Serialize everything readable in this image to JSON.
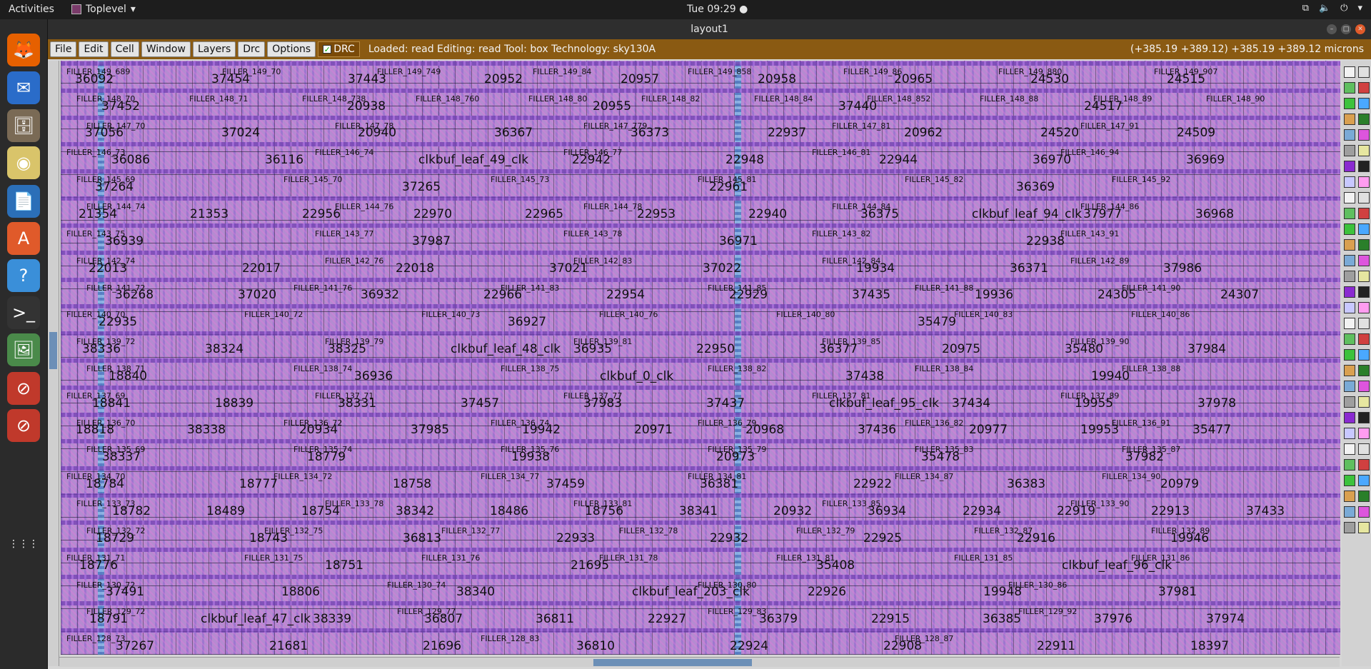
{
  "topbar": {
    "activities": "Activities",
    "app_name": "Toplevel",
    "clock": "Tue 09:29"
  },
  "window": {
    "title": "layout1",
    "menu": [
      "File",
      "Edit",
      "Cell",
      "Window",
      "Layers",
      "Drc",
      "Options"
    ],
    "drc_label": "DRC",
    "status": "Loaded: read  Editing: read  Tool: box   Technology: sky130A",
    "coords": "(+385.19 +389.12) +385.19 +389.12 microns"
  },
  "dock": {
    "items": [
      "firefox-icon",
      "thunderbird-icon",
      "files-icon",
      "rhythmbox-icon",
      "writer-icon",
      "software-icon",
      "help-icon",
      "terminal-icon",
      "image-viewer-icon",
      "app-icon",
      "app-icon",
      "show-apps-icon"
    ]
  },
  "layout": {
    "rows": [
      {
        "small": [
          "FILLER_149_689",
          "FILLER_149_70",
          "FILLER_149_749",
          "FILLER_149_84",
          "FILLER_149_858",
          "FILLER_149_86",
          "FILLER_149_880",
          "FILLER_149_907"
        ],
        "big": [
          "36092",
          "37454",
          "37443",
          "20952",
          "20957",
          "20958",
          "20965",
          "24530",
          "24515"
        ]
      },
      {
        "small": [
          "FILLER_148_70",
          "FILLER_148_71",
          "FILLER_148_738",
          "FILLER_148_760",
          "FILLER_148_80",
          "FILLER_148_82",
          "FILLER_148_84",
          "FILLER_148_852",
          "FILLER_148_88",
          "FILLER_148_89",
          "FILLER_148_90"
        ],
        "big": [
          "37452",
          "20938",
          "20955",
          "37440",
          "24517"
        ]
      },
      {
        "small": [
          "FILLER_147_70",
          "FILLER_147_78",
          "FILLER_147_779",
          "FILLER_147_81",
          "FILLER_147_91"
        ],
        "big": [
          "37056",
          "37024",
          "20940",
          "36367",
          "36373",
          "22937",
          "20962",
          "24520",
          "24509"
        ]
      },
      {
        "small": [
          "FILLER_146_73",
          "FILLER_146_74",
          "FILLER_146_77",
          "FILLER_146_81",
          "FILLER_146_94"
        ],
        "big": [
          "36086",
          "36116",
          "clkbuf_leaf_49_clk",
          "22942",
          "22948",
          "22944",
          "36970",
          "36969"
        ]
      },
      {
        "small": [
          "FILLER_145_69",
          "FILLER_145_70",
          "FILLER_145_73",
          "FILLER_145_81",
          "FILLER_145_82",
          "FILLER_145_92"
        ],
        "big": [
          "37264",
          "37265",
          "22961",
          "36369"
        ]
      },
      {
        "small": [
          "FILLER_144_74",
          "FILLER_144_76",
          "FILLER_144_78",
          "FILLER_144_84",
          "FILLER_144_86"
        ],
        "big": [
          "21354",
          "21353",
          "22956",
          "22970",
          "22965",
          "22953",
          "22940",
          "36375",
          "clkbuf_leaf_94_clk",
          "37977",
          "36968"
        ]
      },
      {
        "small": [
          "FILLER_143_75",
          "FILLER_143_77",
          "FILLER_143_78",
          "FILLER_143_82",
          "FILLER_143_91"
        ],
        "big": [
          "36939",
          "37987",
          "36971",
          "22938"
        ]
      },
      {
        "small": [
          "FILLER_142_74",
          "FILLER_142_76",
          "FILLER_142_83",
          "FILLER_142_84",
          "FILLER_142_89"
        ],
        "big": [
          "22013",
          "22017",
          "22018",
          "37021",
          "37022",
          "19934",
          "36371",
          "37986"
        ]
      },
      {
        "small": [
          "FILLER_141_72",
          "FILLER_141_76",
          "FILLER_141_83",
          "FILLER_141_85",
          "FILLER_141_88",
          "FILLER_141_90"
        ],
        "big": [
          "36268",
          "37020",
          "36932",
          "22966",
          "22954",
          "22929",
          "37435",
          "19936",
          "24305",
          "24307"
        ]
      },
      {
        "small": [
          "FILLER_140_70",
          "FILLER_140_72",
          "FILLER_140_73",
          "FILLER_140_76",
          "FILLER_140_80",
          "FILLER_140_83",
          "FILLER_140_86"
        ],
        "big": [
          "22935",
          "36927",
          "35479"
        ]
      },
      {
        "small": [
          "FILLER_139_72",
          "FILLER_139_79",
          "FILLER_139_81",
          "FILLER_139_85",
          "FILLER_139_90"
        ],
        "big": [
          "38336",
          "38324",
          "38325",
          "clkbuf_leaf_48_clk",
          "36935",
          "22950",
          "36377",
          "20975",
          "35480",
          "37984"
        ]
      },
      {
        "small": [
          "FILLER_138_71",
          "FILLER_138_74",
          "FILLER_138_75",
          "FILLER_138_82",
          "FILLER_138_84",
          "FILLER_138_88"
        ],
        "big": [
          "18840",
          "36936",
          "clkbuf_0_clk",
          "37438",
          "19940"
        ]
      },
      {
        "small": [
          "FILLER_137_69",
          "FILLER_137_71",
          "FILLER_137_77",
          "FILLER_137_81",
          "FILLER_137_89"
        ],
        "big": [
          "18841",
          "18839",
          "38331",
          "37457",
          "37983",
          "37437",
          "clkbuf_leaf_95_clk",
          "37434",
          "19955",
          "37978"
        ]
      },
      {
        "small": [
          "FILLER_136_70",
          "FILLER_136_72",
          "FILLER_136_74",
          "FILLER_136_79",
          "FILLER_136_82",
          "FILLER_136_91"
        ],
        "big": [
          "18818",
          "38338",
          "20934",
          "37985",
          "19942",
          "20971",
          "20968",
          "37436",
          "20977",
          "19953",
          "35477"
        ]
      },
      {
        "small": [
          "FILLER_135_69",
          "FILLER_135_74",
          "FILLER_135_76",
          "FILLER_135_79",
          "FILLER_135_83",
          "FILLER_135_87"
        ],
        "big": [
          "38337",
          "18779",
          "19938",
          "20973",
          "35478",
          "37982"
        ]
      },
      {
        "small": [
          "FILLER_134_70",
          "FILLER_134_72",
          "FILLER_134_77",
          "FILLER_134_81",
          "FILLER_134_87",
          "FILLER_134_90"
        ],
        "big": [
          "18784",
          "18777",
          "18758",
          "37459",
          "36381",
          "22922",
          "36383",
          "20979"
        ]
      },
      {
        "small": [
          "FILLER_133_73",
          "FILLER_133_78",
          "FILLER_133_81",
          "FILLER_133_85",
          "FILLER_133_90"
        ],
        "big": [
          "18782",
          "18489",
          "18754",
          "38342",
          "18486",
          "18756",
          "38341",
          "20932",
          "36934",
          "22934",
          "22919",
          "22913",
          "37433"
        ]
      },
      {
        "small": [
          "FILLER_132_72",
          "FILLER_132_75",
          "FILLER_132_77",
          "FILLER_132_78",
          "FILLER_132_79",
          "FILLER_132_87",
          "FILLER_132_89"
        ],
        "big": [
          "18729",
          "18743",
          "36813",
          "22933",
          "22932",
          "22925",
          "22916",
          "19946"
        ]
      },
      {
        "small": [
          "FILLER_131_71",
          "FILLER_131_75",
          "FILLER_131_76",
          "FILLER_131_78",
          "FILLER_131_81",
          "FILLER_131_85",
          "FILLER_131_86"
        ],
        "big": [
          "18776",
          "18751",
          "21695",
          "35408",
          "clkbuf_leaf_96_clk"
        ]
      },
      {
        "small": [
          "FILLER_130_72",
          "FILLER_130_74",
          "FILLER_130_80",
          "FILLER_130_86"
        ],
        "big": [
          "37491",
          "18806",
          "38340",
          "clkbuf_leaf_203_clk",
          "22926",
          "19948",
          "37981"
        ]
      },
      {
        "small": [
          "FILLER_129_72",
          "FILLER_129_77",
          "FILLER_129_83",
          "FILLER_129_92"
        ],
        "big": [
          "18791",
          "clkbuf_leaf_47_clk",
          "38339",
          "36807",
          "36811",
          "22927",
          "36379",
          "22915",
          "36385",
          "37976",
          "37974"
        ]
      },
      {
        "small": [
          "FILLER_128_73",
          "FILLER_128_83",
          "FILLER_128_87"
        ],
        "big": [
          "37267",
          "21681",
          "21696",
          "36810",
          "22924",
          "22908",
          "22911",
          "18397"
        ]
      }
    ]
  }
}
